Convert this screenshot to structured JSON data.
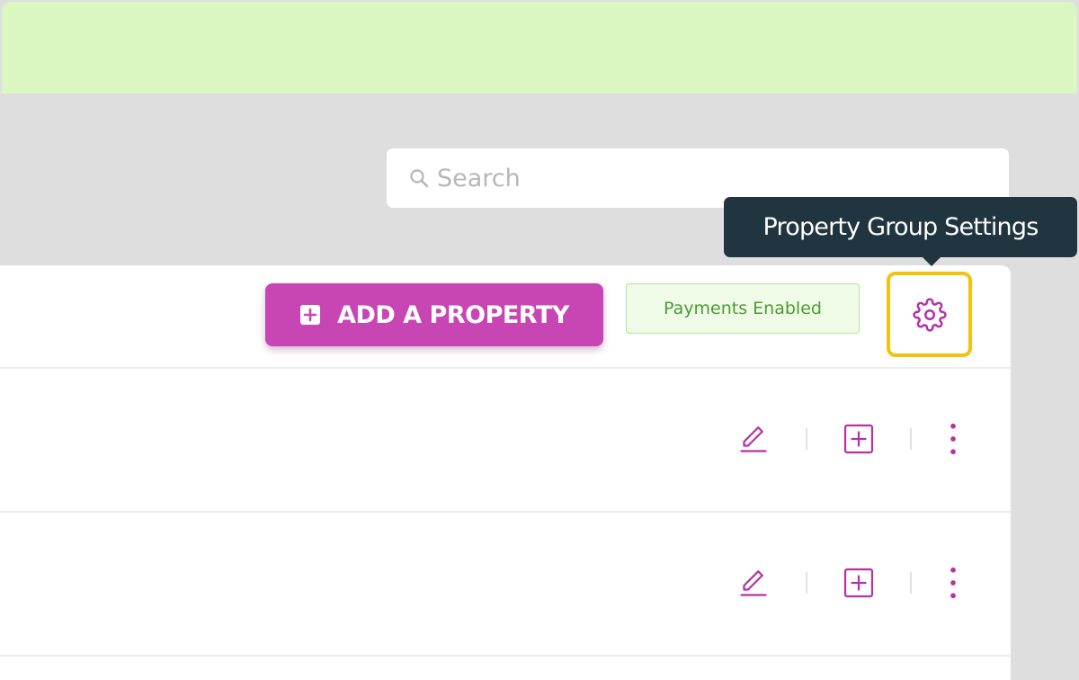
{
  "search": {
    "placeholder": "Search",
    "icon": "search-icon"
  },
  "toolbar": {
    "add_property_label": "ADD A PROPERTY",
    "add_property_icon": "plus-square-icon",
    "payments_badge": "Payments Enabled",
    "settings_icon": "gear-icon"
  },
  "tooltip": {
    "text": "Property Group Settings"
  },
  "rows": [
    {
      "actions": [
        "edit-icon",
        "add-icon",
        "more-vertical-icon"
      ]
    },
    {
      "actions": [
        "edit-icon",
        "add-icon",
        "more-vertical-icon"
      ]
    }
  ],
  "colors": {
    "banner": "#dbf7c1",
    "accent": "#c845b4",
    "badge_text": "#4e9a36",
    "tooltip_bg": "#203540",
    "highlight": "#f4c20d"
  }
}
